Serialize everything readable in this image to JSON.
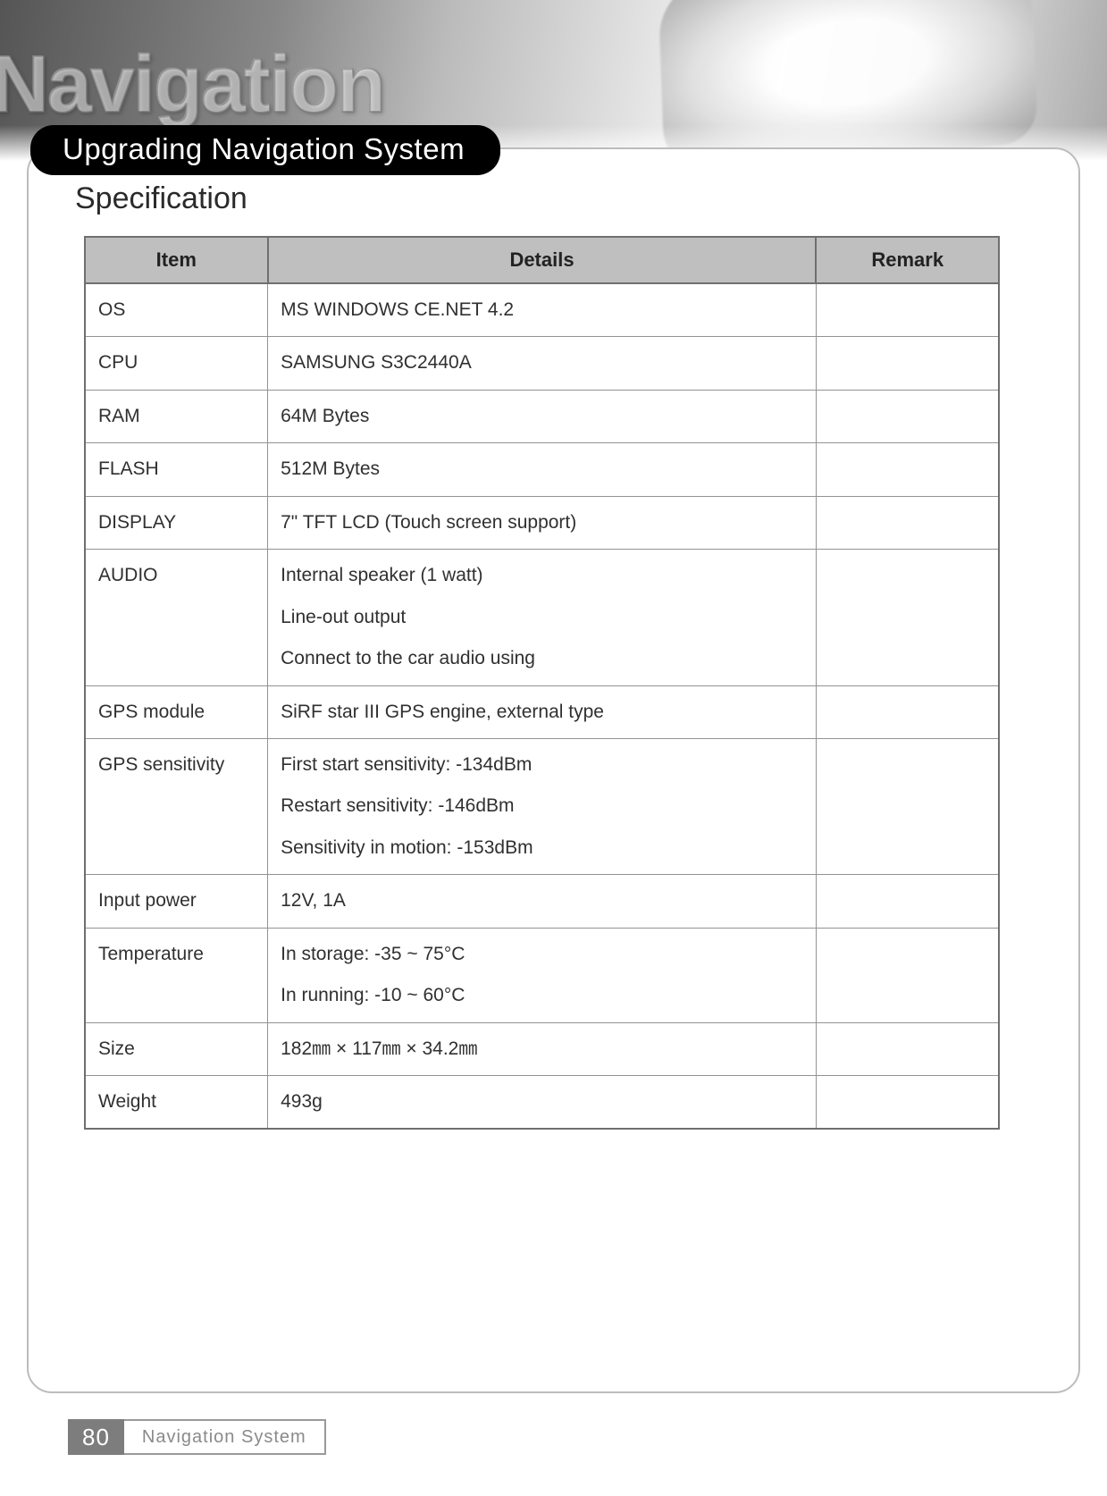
{
  "hero": {
    "background_title": "Navigation"
  },
  "pill": {
    "label": "Upgrading Navigation System"
  },
  "section": {
    "title": "Specification"
  },
  "table": {
    "headers": {
      "item": "Item",
      "details": "Details",
      "remark": "Remark"
    },
    "rows": [
      {
        "item": "OS",
        "details": [
          "MS WINDOWS CE.NET 4.2"
        ],
        "remark": ""
      },
      {
        "item": "CPU",
        "details": [
          "SAMSUNG S3C2440A"
        ],
        "remark": ""
      },
      {
        "item": "RAM",
        "details": [
          "64M Bytes"
        ],
        "remark": ""
      },
      {
        "item": "FLASH",
        "details": [
          "512M Bytes"
        ],
        "remark": ""
      },
      {
        "item": "DISPLAY",
        "details": [
          "7\" TFT LCD (Touch screen support)"
        ],
        "remark": ""
      },
      {
        "item": "AUDIO",
        "details": [
          "Internal speaker (1 watt)",
          "Line-out output",
          "Connect to the car audio using"
        ],
        "remark": ""
      },
      {
        "item": "GPS module",
        "details": [
          "SiRF star III GPS engine, external type"
        ],
        "remark": ""
      },
      {
        "item": "GPS sensitivity",
        "details": [
          "First start sensitivity: -134dBm",
          "Restart sensitivity: -146dBm",
          "Sensitivity in motion: -153dBm"
        ],
        "remark": ""
      },
      {
        "item": "Input power",
        "details": [
          "12V, 1A"
        ],
        "remark": ""
      },
      {
        "item": "Temperature",
        "details": [
          "In storage: -35 ~ 75°C",
          "In running: -10 ~ 60°C"
        ],
        "remark": ""
      },
      {
        "item": "Size",
        "details": [
          "182㎜ × 117㎜ × 34.2㎜"
        ],
        "remark": ""
      },
      {
        "item": "Weight",
        "details": [
          "493g"
        ],
        "remark": ""
      }
    ]
  },
  "footer": {
    "page_number": "80",
    "label": "Navigation System"
  }
}
